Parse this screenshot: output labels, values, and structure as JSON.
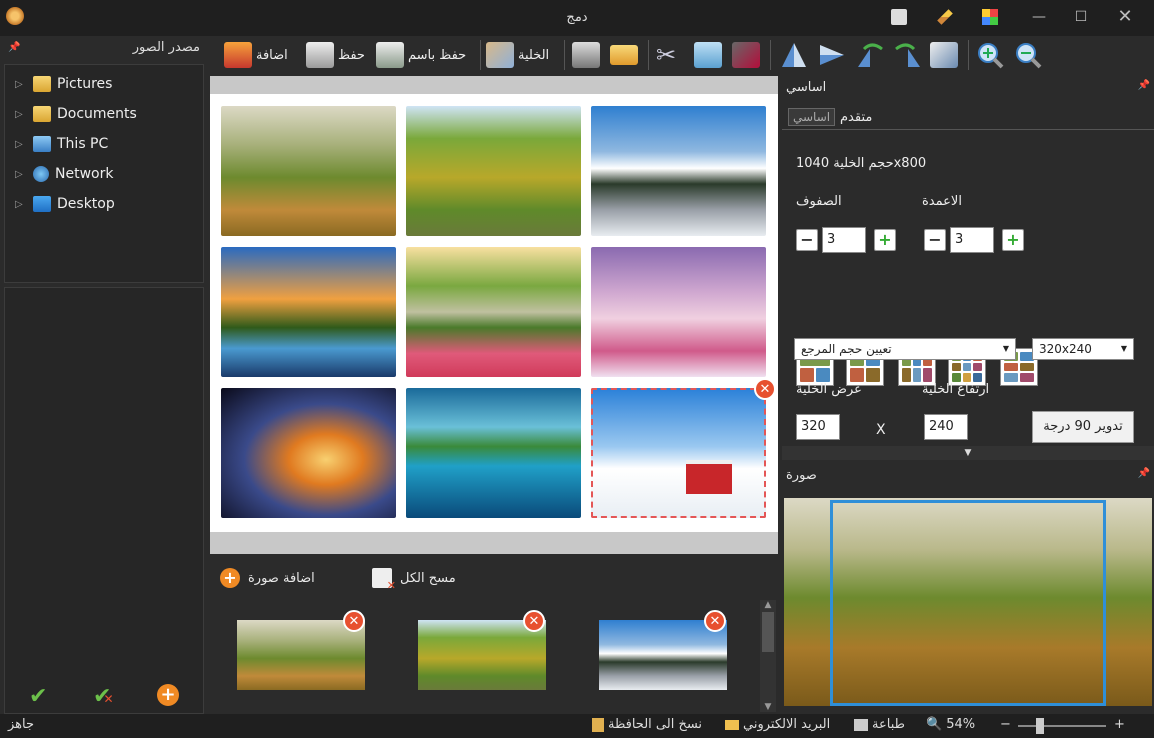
{
  "window": {
    "title": "دمج"
  },
  "toolbar": {
    "add_label": "اضافة",
    "save_label": "حفظ",
    "save_as_label": "حفظ باسم",
    "cell_label": "الخلية"
  },
  "left_panel": {
    "title": "مصدر الصور",
    "tree": [
      {
        "label": "Pictures"
      },
      {
        "label": "Documents"
      },
      {
        "label": "This PC"
      },
      {
        "label": "Network"
      },
      {
        "label": "Desktop"
      }
    ]
  },
  "strip": {
    "add_image_label": "اضافة صورة",
    "clear_all_label": "مسح الكل"
  },
  "right_panel": {
    "section_title": "اساسي",
    "tab_basic": "اساسي",
    "tab_advanced": "متقدم",
    "cell_size_text": "حجم الخلية 1040x800",
    "rows_label": "الصفوف",
    "cols_label": "الاعمدة",
    "rows_value": "3",
    "cols_value": "3",
    "ref_size_select": "تعيين حجم المرجع",
    "size_preset_select": "320x240",
    "cell_width_label": "عرض الخلية",
    "cell_height_label": "ارتفاع الخلية",
    "cell_width_value": "320",
    "cell_height_value": "240",
    "times_symbol": "X",
    "rotate_label": "تدوير 90 درجة",
    "image_section_title": "صورة"
  },
  "status": {
    "ready": "جاهز",
    "copy_clipboard": "نسخ الى الحافظة",
    "email": "البريد الالكتروني",
    "print": "طباعة",
    "zoom": "54%"
  },
  "colors": {
    "accent_blue": "#2f8fd8",
    "remove_red": "#e7502f",
    "add_orange": "#f08a24",
    "check_green": "#6cc04a"
  }
}
